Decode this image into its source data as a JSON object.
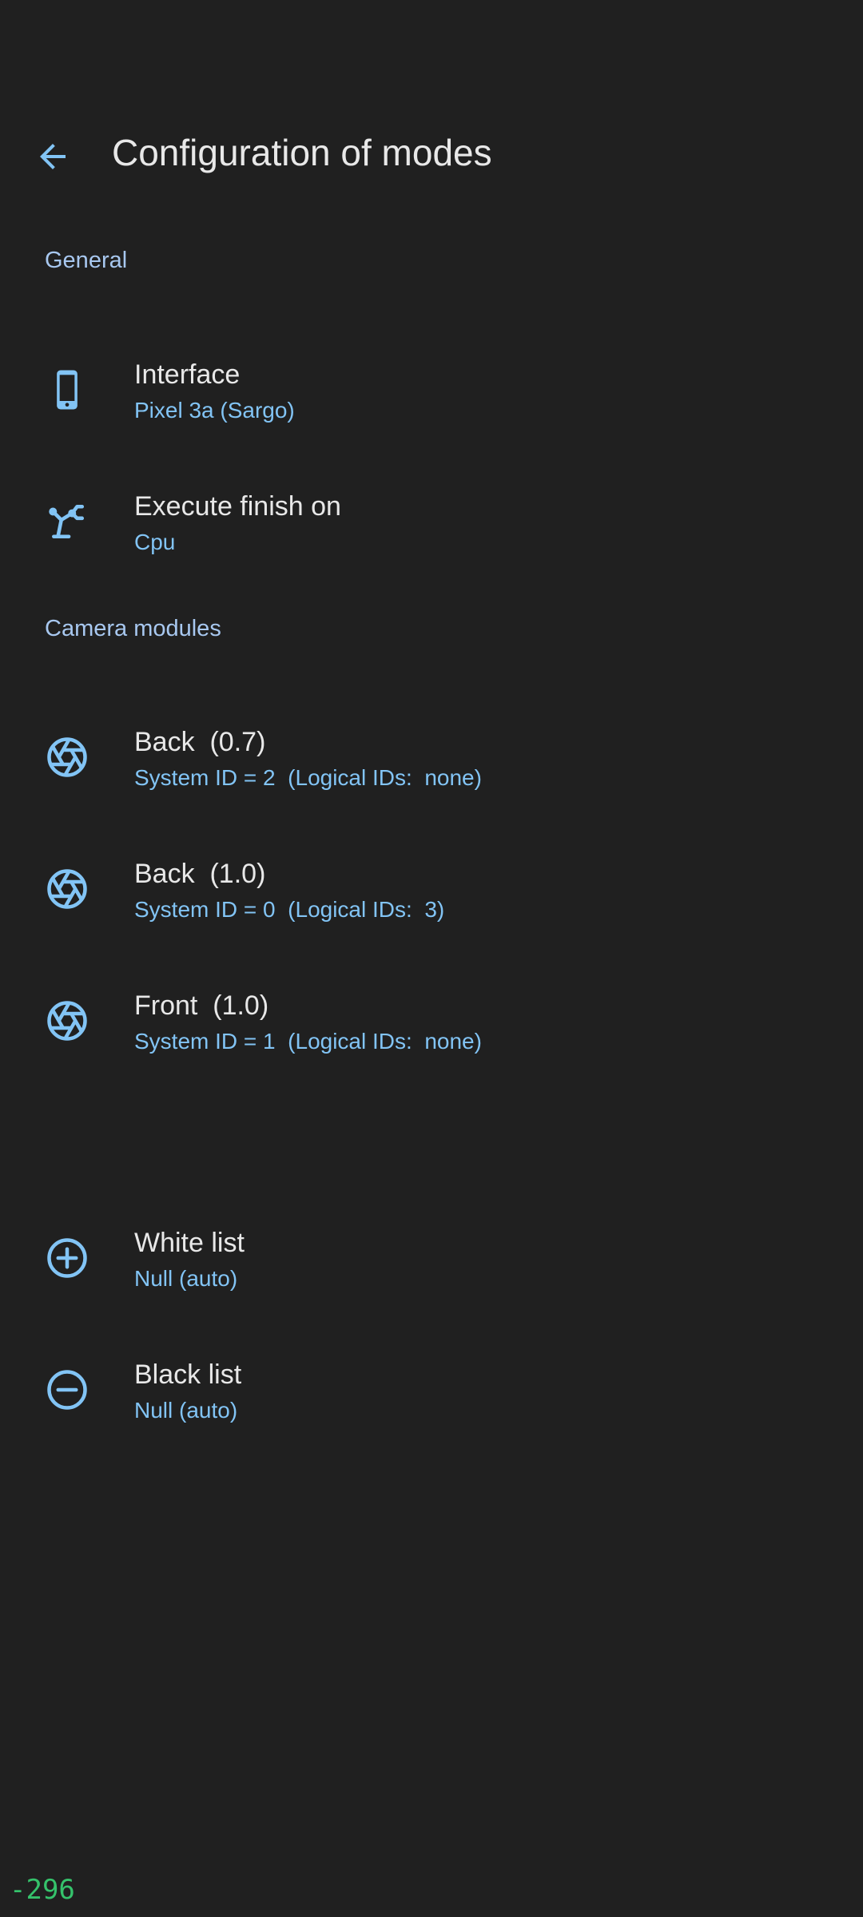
{
  "header": {
    "back_icon": "arrow-back-icon",
    "title": "Configuration of modes"
  },
  "sections": {
    "general": {
      "label": "General",
      "items": [
        {
          "icon": "smartphone-icon",
          "title": "Interface",
          "summary": "Pixel 3a (Sargo)"
        },
        {
          "icon": "robot-arm-icon",
          "title": "Execute finish on",
          "summary": "Cpu"
        }
      ]
    },
    "camera_modules": {
      "label": "Camera modules",
      "items": [
        {
          "icon": "camera-shutter-icon",
          "title": "Back  (0.7)",
          "summary": "System ID = 2  (Logical IDs:  none)"
        },
        {
          "icon": "camera-shutter-icon",
          "title": "Back  (1.0)",
          "summary": "System ID = 0  (Logical IDs:  3)"
        },
        {
          "icon": "camera-shutter-icon",
          "title": "Front  (1.0)",
          "summary": "System ID = 1  (Logical IDs:  none)"
        }
      ]
    },
    "lists": {
      "items": [
        {
          "icon": "add-circle-icon",
          "title": "White list",
          "summary": "Null (auto)"
        },
        {
          "icon": "remove-circle-icon",
          "title": "Black list",
          "summary": "Null (auto)"
        }
      ]
    }
  },
  "overlay": {
    "debug_counter": "-296"
  },
  "colors": {
    "background": "#202020",
    "accent": "#82c4f5",
    "section_header": "#a8c8f0",
    "title_text": "#e8e8e8",
    "debug_text": "#35c26b"
  }
}
